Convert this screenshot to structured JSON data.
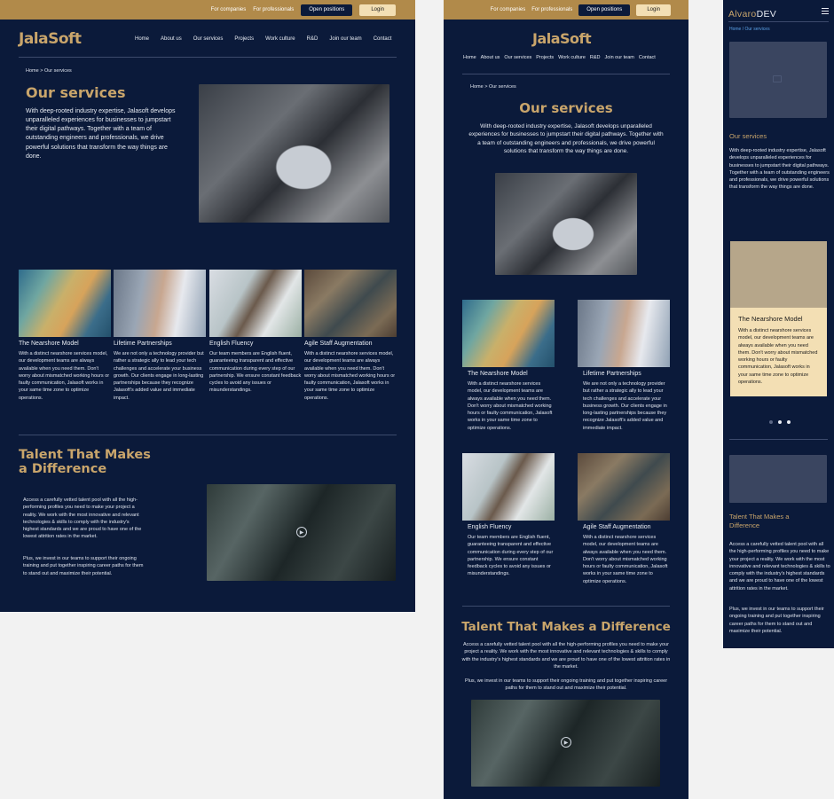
{
  "topbar": {
    "companies": "For companies",
    "professionals": "For professionals",
    "open_positions": "Open positions",
    "login": "Login"
  },
  "brand": {
    "logo": "JalaSoft"
  },
  "nav": [
    "Home",
    "About us",
    "Our services",
    "Projects",
    "Work culture",
    "R&D",
    "Join our team",
    "Contact"
  ],
  "breadcrumb": "Home > Our services",
  "hero": {
    "title": "Our services",
    "text": "With deep-rooted industry expertise, Jalasoft develops unparalleled experiences for businesses to jumpstart their digital pathways. Together with a team of outstanding engineers and professionals, we drive powerful solutions that transform the way things are done."
  },
  "cards": [
    {
      "title": "The Nearshore Model",
      "text": "With a distinct nearshore services model, our development teams are always available when you need them. Don't worry about mismatched working hours or faulty communication, Jalasoft works in your same time zone to optimize operations."
    },
    {
      "title": "Lifetime Partnerships",
      "text": "We are not only a technology provider but rather a strategic ally to lead your tech challenges and accelerate your business growth. Our clients engage in long-lasting partnerships because they recognize Jalasoft's added value and immediate impact."
    },
    {
      "title": "English Fluency",
      "text": "Our team members are English fluent, guaranteeing transparent and effective communication during every step of our partnership. We ensure constant feedback cycles to avoid any issues or misunderstandings."
    },
    {
      "title": "Agile Staff Augmentation",
      "text": "With a distinct nearshore services model, our development teams are always available when you need them. Don't worry about mismatched working hours or faulty communication, Jalasoft works in your same time zone to optimize operations."
    }
  ],
  "talent": {
    "title": "Talent That Makes a Difference",
    "p1": "Access a carefully vetted talent pool with all the high-performing profiles you need to make your project a reality. We work with the most innovative and relevant technologies & skills to comply with the industry's highest standards and we are proud to have one of the lowest attrition rates in the market.",
    "p2": "Plus, we invest in our teams to support their ongoing training and put together inspiring career paths for them to stand out and maximize their potential."
  },
  "mobile": {
    "brand_a": "Alvaro",
    "brand_b": "DEV",
    "breadcrumb_home": "Home",
    "breadcrumb_current": "/ Our services",
    "hero_text": "With deep-rooted industry expertise, Jalasoft develops unparalleled experiences for businesses to jumpstart their digital pathways. Together with a team of outstanding engineers and professionals, we drive powerful solutions that transform the way things are done.",
    "carousel_dots": 3
  },
  "colors": {
    "navy": "#0b1a3a",
    "gold": "#c9a56b",
    "topbar": "#b18a4a",
    "cream": "#f3dfb4"
  }
}
